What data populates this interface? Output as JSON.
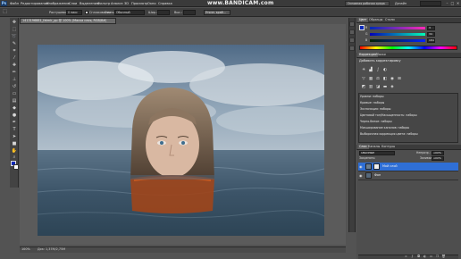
{
  "app": {
    "logo": "Ps"
  },
  "menubar": {
    "items": [
      "Файл",
      "Редактирование",
      "Изображение",
      "Слои",
      "Выделение",
      "Фильтр",
      "Анализ",
      "3D",
      "Просмотр",
      "Окно",
      "Справка"
    ],
    "watermark": "www.BANDICAM.com",
    "workspace": "Основная рабочая среда",
    "design": "Дизайн",
    "window_controls": [
      "–",
      "□",
      "✕"
    ]
  },
  "options": {
    "feather_label": "Растушевка:",
    "feather_value": "0 пикс",
    "antialias_label": "Сглаживание",
    "style_label": "Стиль:",
    "style_value": "Обычный",
    "width_label": "Шир.:",
    "height_label": "Выс.:",
    "refine_button": "Уточн. край..."
  },
  "document": {
    "tab_title": "1413196881_fatmir_pp @ 100% (Маска слоя, RGB/8#)",
    "zoom": "100%",
    "info": "Док: 1,37M/2,75M"
  },
  "colors": {
    "accent": "#2f6fd6",
    "foreground": "#0b2ab8",
    "background": "#ffffff"
  },
  "color_panel": {
    "tabs": [
      "Цвет",
      "Образцы",
      "Стили"
    ],
    "channels": [
      {
        "label": "R",
        "value": "3"
      },
      {
        "label": "G",
        "value": "34"
      },
      {
        "label": "B",
        "value": "184"
      }
    ]
  },
  "adjustments_panel": {
    "tabs": [
      "Коррекция",
      "Маски"
    ],
    "title": "Добавить корректировку",
    "presets": [
      "Уровни: наборы",
      "Кривые: наборы",
      "Экспозиция: наборы",
      "Цветовой тон/Насыщенность: наборы",
      "Черно-белое: наборы",
      "Микширование каналов: наборы",
      "Выборочная коррекция цвета: наборы"
    ]
  },
  "layers_panel": {
    "tabs": [
      "Слои",
      "Каналы",
      "Контуры"
    ],
    "blend_mode": "Обычные",
    "opacity_label": "Непрозр.:",
    "opacity_value": "100%",
    "lock_label": "Закрепить:",
    "fill_label": "Заливка:",
    "fill_value": "100%",
    "layers": [
      {
        "name": "Мой слой",
        "selected": true
      },
      {
        "name": "Фон",
        "selected": false
      }
    ]
  }
}
